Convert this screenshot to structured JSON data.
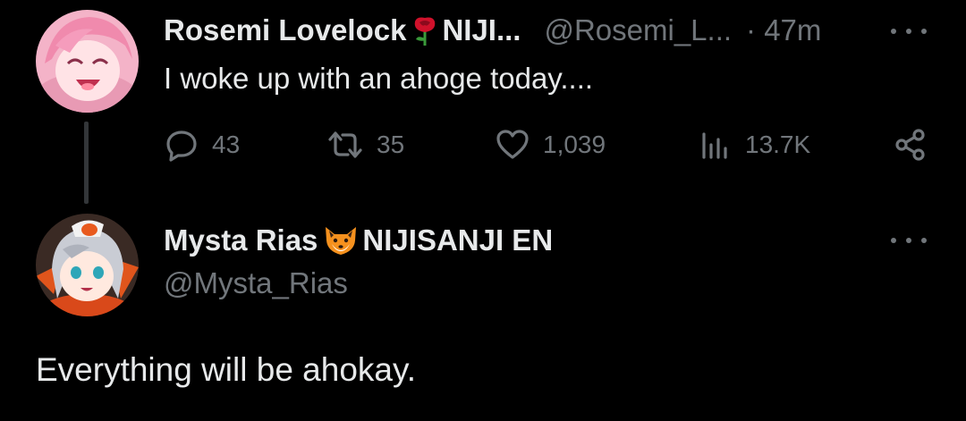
{
  "tweet": {
    "author_name": "Rosemi Lovelock",
    "author_emoji": "rose-emoji",
    "author_suffix": "NIJI...",
    "handle": "@Rosemi_L...",
    "time": "· 47m",
    "text": "I woke up with an ahoge today....",
    "stats": {
      "replies": "43",
      "retweets": "35",
      "likes": "1,039",
      "views": "13.7K"
    }
  },
  "reply": {
    "author_name": "Mysta Rias",
    "author_emoji": "fox-emoji",
    "author_suffix": "NIJISANJI EN",
    "handle": "@Mysta_Rias",
    "text": "Everything will be ahokay."
  },
  "colors": {
    "background": "#000000",
    "primary_text": "#e7e9ea",
    "secondary_text": "#71767b",
    "thread_line": "#333639"
  }
}
